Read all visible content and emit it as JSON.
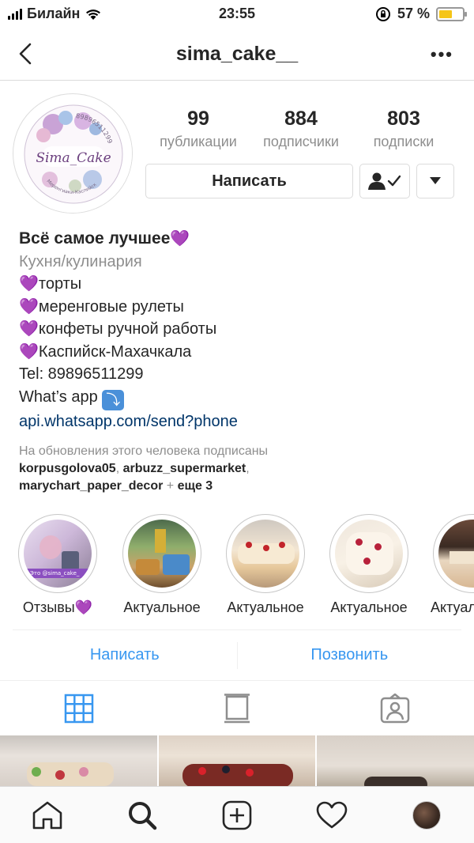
{
  "status_bar": {
    "carrier": "Билайн",
    "time": "23:55",
    "battery": "57 %",
    "battery_level": 0.57
  },
  "header": {
    "username": "sima_cake__"
  },
  "avatar": {
    "ring_text": "89896511299",
    "logo_text": "Sima_Cake",
    "bottom_text": "Меренгиаки-Каспийск"
  },
  "stats": [
    {
      "value": "99",
      "label": "публикации"
    },
    {
      "value": "884",
      "label": "подписчики"
    },
    {
      "value": "803",
      "label": "подписки"
    }
  ],
  "buttons": {
    "message": "Написать"
  },
  "bio": {
    "name": "Всё самое лучшее",
    "category": "Кухня/кулинария",
    "lines": [
      "торты",
      "меренговые рулеты",
      "конфеты ручной работы",
      "Каспийск-Махачкала"
    ],
    "phone": "Tel: 89896511299",
    "whatsapp": "What’s app",
    "link": "api.whatsapp.com/send?phone",
    "heart": "💜",
    "arrow": "⤵"
  },
  "followed_by": {
    "hint": "На обновления этого человека подписаны",
    "users": [
      "korpusgolova05",
      "arbuzz_supermarket",
      "marychart_paper_decor"
    ],
    "more": "+ еще 3"
  },
  "highlights": [
    {
      "label": "Отзывы",
      "caption": "Это @sima_cake_"
    },
    {
      "label": "Актуальное"
    },
    {
      "label": "Актуальное"
    },
    {
      "label": "Актуальное"
    },
    {
      "label": "Актуал"
    }
  ],
  "contact": {
    "message": "Написать",
    "call": "Позвонить"
  },
  "colors": {
    "accent": "#3897f0",
    "link": "#003569",
    "heart": "#9b3fd6",
    "battery": "#f5c518"
  }
}
